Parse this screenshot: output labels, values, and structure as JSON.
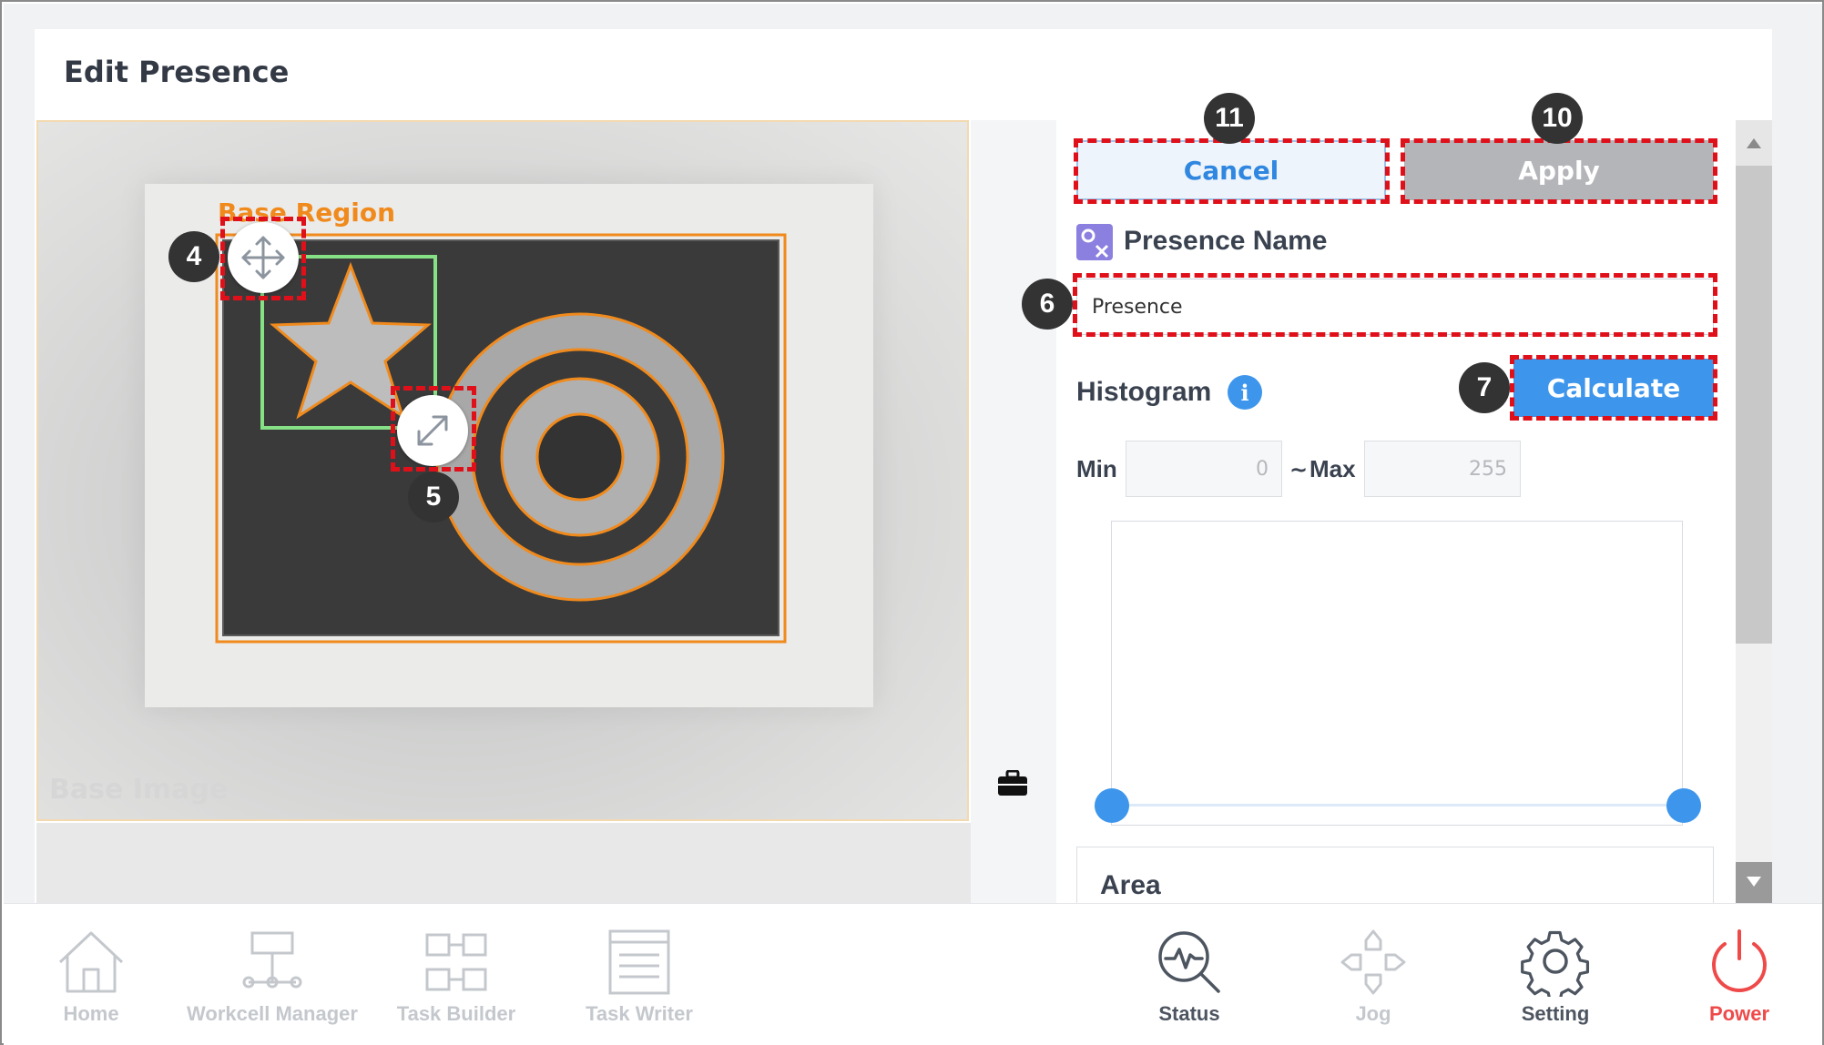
{
  "dialog": {
    "title": "Edit Presence"
  },
  "camera": {
    "region_label": "Base Region",
    "image_label": "Base Image"
  },
  "buttons": {
    "cancel": "Cancel",
    "apply": "Apply",
    "calculate": "Calculate"
  },
  "presence_name": {
    "label": "Presence Name",
    "value": "Presence"
  },
  "histogram": {
    "label": "Histogram",
    "min_label": "Min",
    "min_value": "0",
    "separator": "~",
    "max_label": "Max",
    "max_value": "255"
  },
  "area": {
    "label": "Area"
  },
  "callouts": {
    "move": "4",
    "resize": "5",
    "name": "6",
    "calculate": "7",
    "apply": "10",
    "cancel": "11"
  },
  "nav": {
    "home": "Home",
    "workcell": "Workcell Manager",
    "task_builder": "Task Builder",
    "task_writer": "Task Writer",
    "status": "Status",
    "jog": "Jog",
    "setting": "Setting",
    "power": "Power"
  },
  "colors": {
    "accent": "#3d96ec",
    "callout_box": "#e0101a",
    "region_outline": "#f08a1c",
    "roi_box": "#7fe07f",
    "power": "#ef4a4a"
  }
}
